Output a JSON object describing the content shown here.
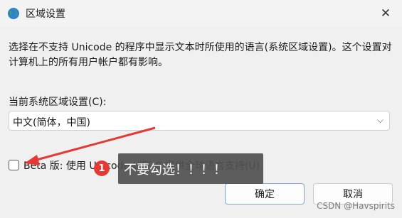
{
  "window": {
    "title": "区域设置",
    "close_glyph": "✕"
  },
  "dialog": {
    "description": "选择在不支持 Unicode 的程序中显示文本时所使用的语言(系统区域设置)。这个设置对计算机上的所有用户帐户都有影响。",
    "current_locale_label": "当前系统区域设置(C):",
    "current_locale_value": "中文(简体，中国)",
    "beta_checkbox": {
      "label": "Beta 版: 使用 Unicode UTF-8 提供全球语言支持(U)",
      "checked": false
    },
    "buttons": {
      "ok": "确定",
      "cancel": "取消"
    }
  },
  "annotation": {
    "step_number": "1",
    "tooltip": "不要勾选！！！！",
    "arrow_color": "#e53935"
  },
  "watermark": "CSDN @Havspirits",
  "icons": {
    "window_icon": "globe-icon",
    "dropdown": "chevron-down-icon"
  }
}
